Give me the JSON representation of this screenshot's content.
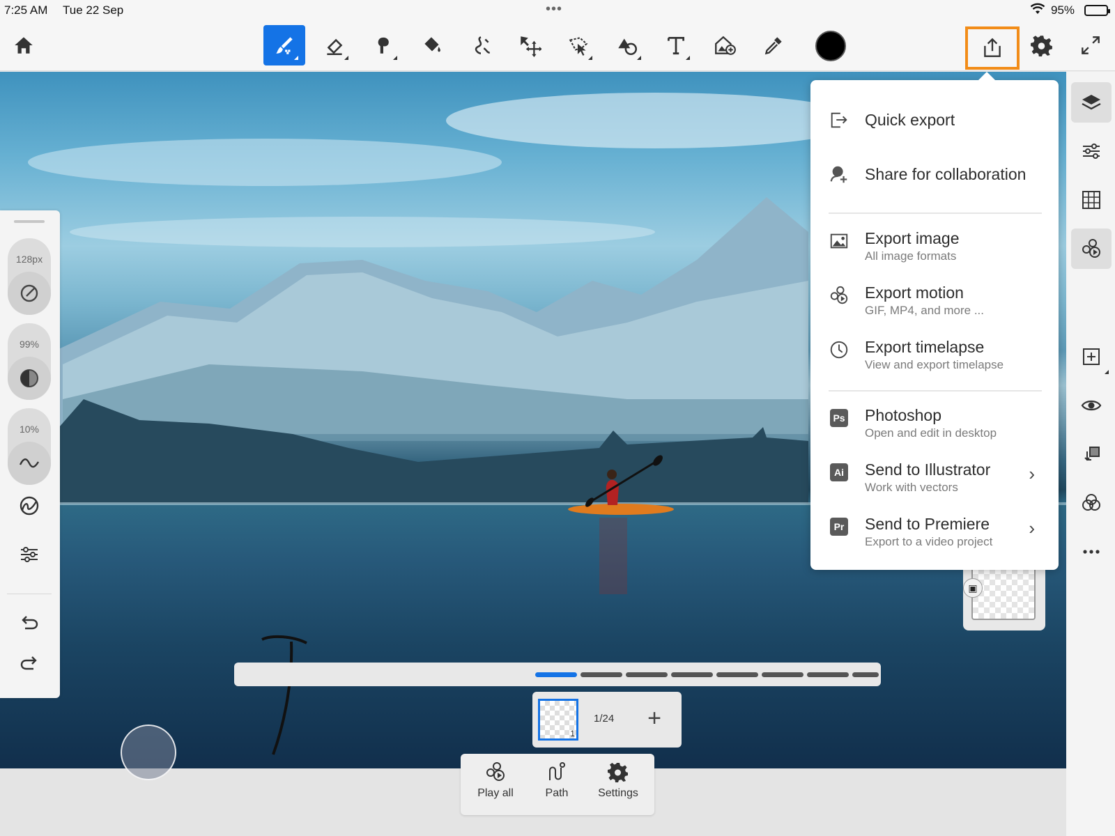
{
  "status_bar": {
    "time": "7:25 AM",
    "date": "Tue 22 Sep",
    "battery": "95%"
  },
  "toolbar": {
    "tools": [
      {
        "name": "home-icon"
      },
      {
        "name": "paint-brush-icon",
        "active": true
      },
      {
        "name": "eraser-icon"
      },
      {
        "name": "smudge-icon"
      },
      {
        "name": "fill-bucket-icon"
      },
      {
        "name": "liquify-icon"
      },
      {
        "name": "transform-move-icon"
      },
      {
        "name": "selection-lasso-icon"
      },
      {
        "name": "shapes-icon"
      },
      {
        "name": "text-icon"
      },
      {
        "name": "place-image-icon"
      },
      {
        "name": "eyedropper-icon"
      }
    ],
    "current_color": "#000000",
    "accent": "#1473e6",
    "export_highlight": "#f28c18"
  },
  "left_panel": {
    "size": "128px",
    "opacity": "99%",
    "smoothing": "10%"
  },
  "export_menu": {
    "items": [
      {
        "icon": "export-arrow-icon",
        "title": "Quick export",
        "subtitle": ""
      },
      {
        "icon": "share-user-icon",
        "title": "Share for collaboration",
        "subtitle": ""
      },
      {
        "icon": "image-icon",
        "title": "Export image",
        "subtitle": "All image formats"
      },
      {
        "icon": "motion-icon",
        "title": "Export motion",
        "subtitle": "GIF, MP4, and more ..."
      },
      {
        "icon": "clock-icon",
        "title": "Export timelapse",
        "subtitle": "View and export timelapse"
      },
      {
        "icon": "photoshop-icon",
        "badge": "Ps",
        "title": "Photoshop",
        "subtitle": "Open and edit in desktop"
      },
      {
        "icon": "illustrator-icon",
        "badge": "Ai",
        "title": "Send to Illustrator",
        "subtitle": "Work with vectors"
      },
      {
        "icon": "premiere-icon",
        "badge": "Pr",
        "title": "Send to Premiere",
        "subtitle": "Export to a video project"
      }
    ]
  },
  "timeline": {
    "frame_count": "1/24",
    "current_frame_number": "1",
    "add_label": "+"
  },
  "bottom_bar": {
    "play_all": "Play all",
    "path": "Path",
    "settings": "Settings"
  }
}
